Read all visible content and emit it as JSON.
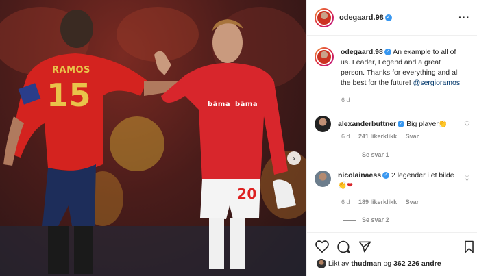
{
  "post": {
    "author": "odegaard.98",
    "caption_text": "An example to all of us. Leader, Legend and a great person. Thanks for everything and all the best for the future!",
    "caption_mention": "@sergioramos",
    "caption_age": "6 d",
    "photo_text": {
      "left_name": "RAMOS",
      "left_number": "15",
      "right_sponsor": "bāma",
      "right_number": "20"
    }
  },
  "header": {
    "more_icon": "ellipsis-icon",
    "more_label": "···"
  },
  "comments": [
    {
      "username": "alexanderbuttner",
      "text": "Big player",
      "emoji": "👏",
      "age": "6 d",
      "likes": "241 likerklikk",
      "reply": "Svar",
      "view_replies": "Se svar 1"
    },
    {
      "username": "nicolainaess",
      "text": "2 legender i et bilde",
      "emoji": "👏❤",
      "age": "6 d",
      "likes": "189 likerklikk",
      "reply": "Svar",
      "view_replies": "Se svar 2"
    }
  ],
  "likes_summary": {
    "prefix": "Likt av",
    "user": "thudman",
    "connector": "og",
    "others": "362 226 andre"
  },
  "icons": {
    "heart": "heart-icon",
    "comment": "comment-icon",
    "share": "share-icon",
    "save": "bookmark-icon",
    "carousel_next": "chevron-right-icon",
    "verified": "verified-badge-icon"
  },
  "colors": {
    "verified_blue": "#3897f0",
    "mention_blue": "#00376b",
    "meta_gray": "#8e8e8e",
    "spain_red": "#d4231f",
    "norway_red": "#d8262c"
  }
}
